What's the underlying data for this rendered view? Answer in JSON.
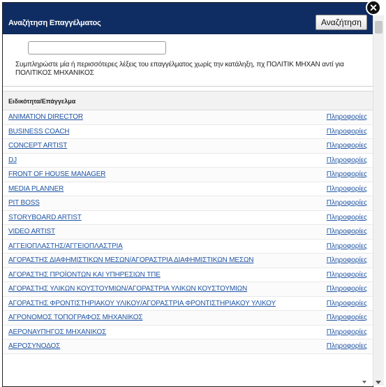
{
  "dialog": {
    "title": "Αναζήτηση Επαγγέλματος",
    "search_button": "Αναζήτηση",
    "close_glyph": "✕"
  },
  "search": {
    "value": "",
    "placeholder": "",
    "hint": "Συμπληρώστε μία ή περισσότερες λέξεις του επαγγέλματος χωρίς την κατάληξη, πχ ΠΟΛΙΤΙΚ ΜΗΧΑΝ αντί για ΠΟΛΙΤΙΚΟΣ ΜΗΧΑΝΙΚΟΣ"
  },
  "table": {
    "header": "Ειδικότητα/Επάγγελμα",
    "info_label": "Πληροφορίες",
    "rows": [
      "ANIMATION DIRECTOR",
      "BUSINESS COACH",
      "CONCEPT ARTIST",
      "DJ",
      "FRONT OF HOUSE MANAGER",
      "MEDIA PLANNER",
      "PIT BOSS",
      "STORYBOARD ARTIST",
      "VIDEO ARTIST",
      "ΑΓΓΕΙΟΠΛΑΣΤΗΣ/ΑΓΓΕΙΟΠΛΑΣΤΡΙΑ",
      "ΑΓΟΡΑΣΤΗΣ ΔΙΑΦΗΜΙΣΤΙΚΩΝ ΜΕΣΩΝ/ΑΓΟΡΑΣΤΡΙΑ ΔΙΑΦΗΜΙΣΤΙΚΩΝ ΜΕΣΩΝ",
      "ΑΓΟΡΑΣΤΗΣ ΠΡΟΪΟΝΤΩΝ ΚΑΙ ΥΠΗΡΕΣΙΩΝ ΤΠΕ",
      "ΑΓΟΡΑΣΤΗΣ ΥΛΙΚΩΝ ΚΟΥΣΤΟΥΜΙΩΝ/ΑΓΟΡΑΣΤΡΙΑ ΥΛΙΚΩΝ ΚΟΥΣΤΟΥΜΙΩΝ",
      "ΑΓΟΡΑΣΤΗΣ ΦΡΟΝΤΙΣΤΗΡΙΑΚΟΥ ΥΛΙΚΟΥ/ΑΓΟΡΑΣΤΡΙΑ ΦΡΟΝΤΙΣΤΗΡΙΑΚΟΥ ΥΛΙΚΟΥ",
      "ΑΓΡΟΝΟΜΟΣ ΤΟΠΟΓΡΑΦΟΣ ΜΗΧΑΝΙΚΟΣ",
      "ΑΕΡΟΝΑΥΠΗΓΟΣ ΜΗΧΑΝΙΚΟΣ",
      "ΑΕΡΟΣΥΝΟΔΟΣ"
    ]
  }
}
